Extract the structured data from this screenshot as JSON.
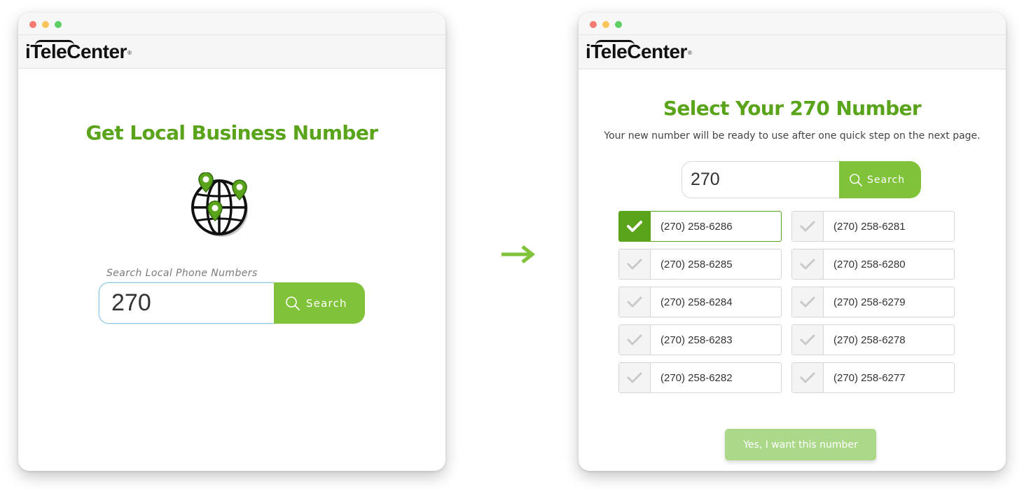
{
  "brand": {
    "logo_prefix": "i",
    "logo_tele": "Tele",
    "logo_suffix": "Center",
    "logo_reg": "®"
  },
  "left_window": {
    "headline": "Get Local Business Number",
    "globe_icon": "globe-with-location-pins",
    "search_label": "Search Local Phone Numbers",
    "search_value": "270",
    "search_button": "Search"
  },
  "arrow_icon": "right-arrow",
  "right_window": {
    "headline": "Select Your 270 Number",
    "subline": "Your new number will be ready to use after one quick step on the next page.",
    "search_value": "270",
    "search_button": "Search",
    "numbers": [
      {
        "number": "(270) 258-6286",
        "selected": true
      },
      {
        "number": "(270) 258-6281",
        "selected": false
      },
      {
        "number": "(270) 258-6285",
        "selected": false
      },
      {
        "number": "(270) 258-6280",
        "selected": false
      },
      {
        "number": "(270) 258-6284",
        "selected": false
      },
      {
        "number": "(270) 258-6279",
        "selected": false
      },
      {
        "number": "(270) 258-6283",
        "selected": false
      },
      {
        "number": "(270) 258-6278",
        "selected": false
      },
      {
        "number": "(270) 258-6282",
        "selected": false
      },
      {
        "number": "(270) 258-6277",
        "selected": false
      }
    ],
    "confirm_button": "Yes, I want this number"
  },
  "colors": {
    "brand_green": "#5aa41c",
    "button_green": "#80c33a",
    "confirm_green": "#acd88a"
  }
}
